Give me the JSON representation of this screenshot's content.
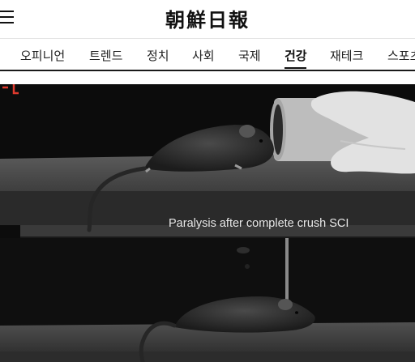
{
  "header": {
    "logo_text": "朝鮮日報",
    "menu_icon": "hamburger-menu-icon"
  },
  "nav": {
    "items": [
      {
        "label": "오피니언"
      },
      {
        "label": "트렌드"
      },
      {
        "label": "정치"
      },
      {
        "label": "사회"
      },
      {
        "label": "국제"
      },
      {
        "label": "건강",
        "active": true
      },
      {
        "label": "재테크"
      },
      {
        "label": "스포츠"
      }
    ]
  },
  "media": {
    "caption": "Paralysis after complete crush SCI"
  },
  "colors": {
    "accent": "#e03a2e",
    "text": "#111111",
    "background": "#ffffff"
  }
}
